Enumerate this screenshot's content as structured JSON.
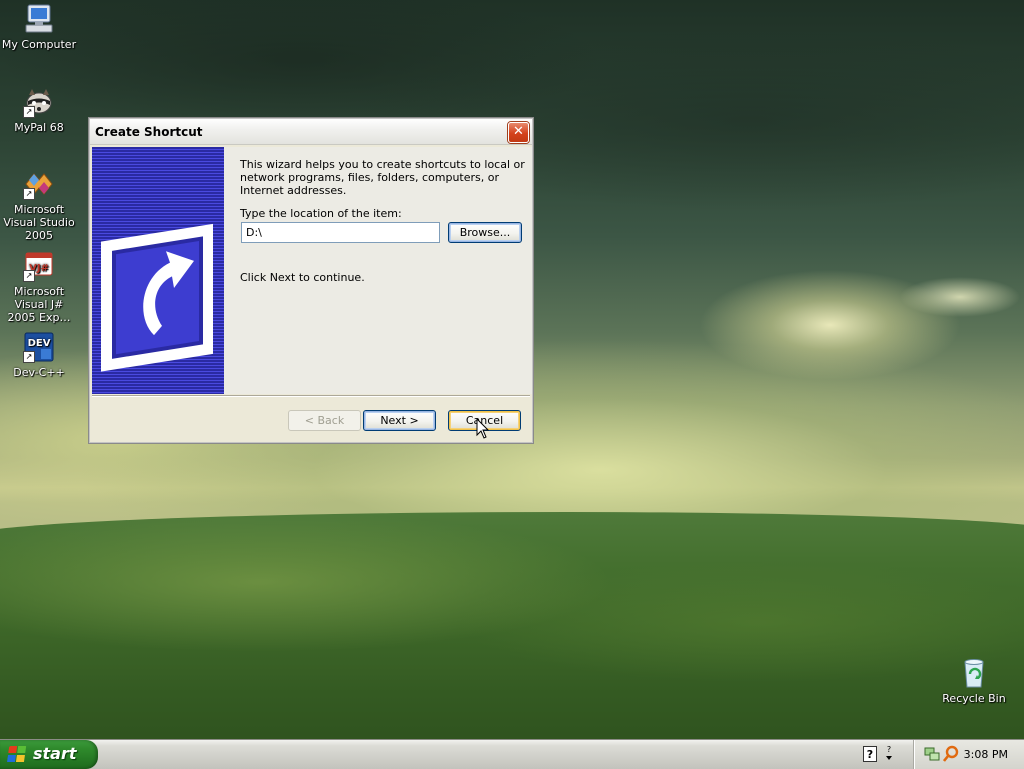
{
  "desktop": {
    "icons": [
      {
        "label": "My Computer"
      },
      {
        "label": "MyPal 68"
      },
      {
        "label": "Microsoft Visual Studio 2005"
      },
      {
        "label": "Microsoft Visual J# 2005 Exp…"
      },
      {
        "label": "Dev-C++"
      },
      {
        "label": "Recycle Bin"
      }
    ]
  },
  "dialog": {
    "title": "Create Shortcut",
    "close_label": "✕",
    "intro": "This wizard helps you to create shortcuts to local or network programs, files, folders, computers, or Internet addresses.",
    "location_label": "Type the location of the item:",
    "location_value": "D:\\",
    "browse_label": "Browse...",
    "continue_text": "Click Next to continue.",
    "back_label": "< Back",
    "next_label": "Next >",
    "cancel_label": "Cancel"
  },
  "taskbar": {
    "start_label": "start",
    "clock": "3:08 PM"
  },
  "colors": {
    "wizard_side": "#2a2aa3",
    "start_green": "#2f8a2c",
    "dialog_bg": "#ece9d8"
  }
}
